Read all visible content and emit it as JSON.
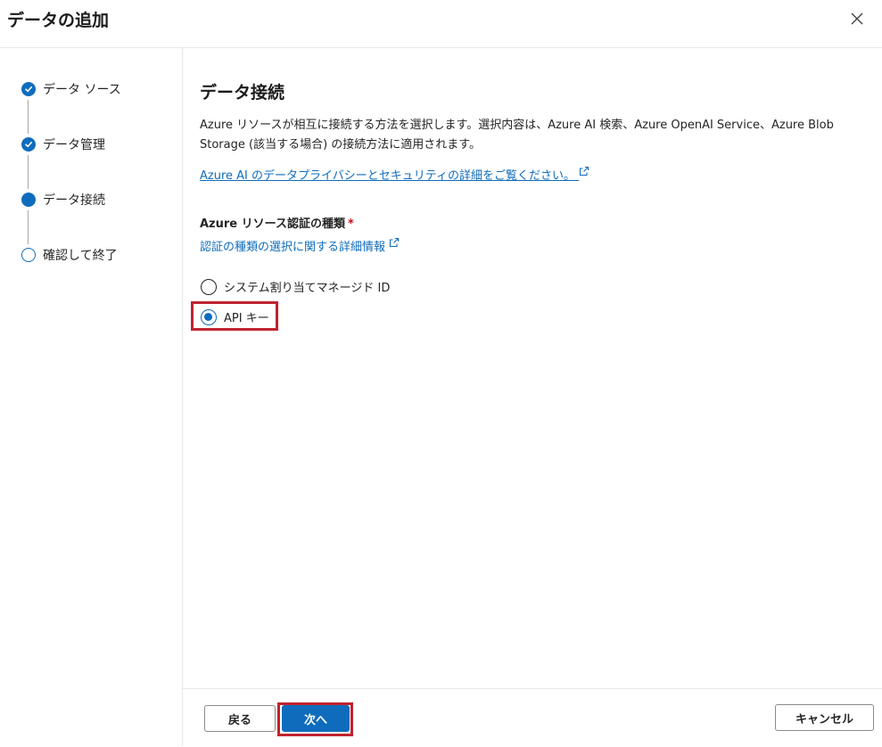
{
  "dialog": {
    "title": "データの追加",
    "close_icon": "close-icon"
  },
  "steps": [
    {
      "label": "データ ソース",
      "state": "done"
    },
    {
      "label": "データ管理",
      "state": "done"
    },
    {
      "label": "データ接続",
      "state": "current"
    },
    {
      "label": "確認して終了",
      "state": "todo"
    }
  ],
  "main": {
    "title": "データ接続",
    "description": "Azure リソースが相互に接続する方法を選択します。選択内容は、Azure AI 検索、Azure OpenAI Service、Azure Blob Storage (該当する場合) の接続方法に適用されます。",
    "privacy_link": "Azure AI のデータプライバシーとセキュリティの詳細をご覧ください。",
    "auth_label": "Azure リソース認証の種類",
    "required_mark": "*",
    "auth_help_link": "認証の種類の選択に関する詳細情報",
    "options": [
      {
        "label": "システム割り当てマネージド ID",
        "checked": false
      },
      {
        "label": "API キー",
        "checked": true
      }
    ]
  },
  "footer": {
    "back_label": "戻る",
    "next_label": "次へ",
    "cancel_label": "キャンセル"
  },
  "colors": {
    "accent": "#0f6cbd",
    "highlight": "#c0232f"
  }
}
